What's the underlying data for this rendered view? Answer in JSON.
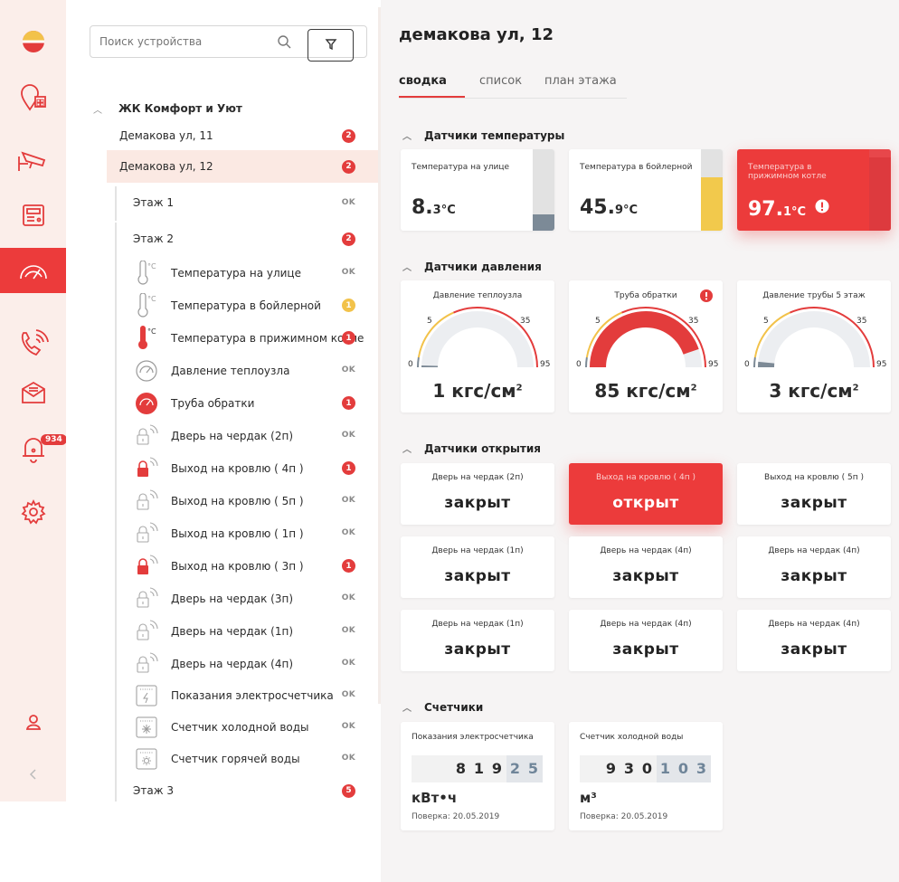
{
  "search": {
    "placeholder": "Поиск устройства"
  },
  "alerts_badge": "934",
  "tree": {
    "complex": "ЖК Комфорт и Уют",
    "buildings": [
      {
        "label": "Демакова ул, 11",
        "count": "2"
      },
      {
        "label": "Демакова ул, 12",
        "count": "2"
      }
    ],
    "floors": [
      {
        "label": "Этаж 1",
        "status": "OK"
      },
      {
        "label": "Этаж 2",
        "count": "2"
      },
      {
        "label": "Этаж 3",
        "count": "5"
      }
    ],
    "devices": [
      {
        "label": "Температура на улице",
        "status": "OK",
        "icon": "thermometer-icon"
      },
      {
        "label": "Температура в бойлерной",
        "count": "1",
        "count_color": "yellow",
        "icon": "thermometer-icon"
      },
      {
        "label": "Температура в прижимном котле",
        "count": "1",
        "icon": "thermometer-alarm-icon"
      },
      {
        "label": "Давление теплоузла",
        "status": "OK",
        "icon": "gauge-icon"
      },
      {
        "label": "Труба обратки",
        "count": "1",
        "icon": "gauge-alarm-icon"
      },
      {
        "label": "Дверь на чердак (2п)",
        "status": "OK",
        "icon": "lock-closed-icon"
      },
      {
        "label": "Выход на кровлю ( 4п )",
        "count": "1",
        "icon": "lock-open-icon"
      },
      {
        "label": "Выход на кровлю ( 5п )",
        "status": "OK",
        "icon": "lock-closed-icon"
      },
      {
        "label": "Выход на кровлю ( 1п )",
        "status": "OK",
        "icon": "lock-closed-icon"
      },
      {
        "label": "Выход на кровлю ( 3п )",
        "count": "1",
        "icon": "lock-open-icon"
      },
      {
        "label": "Дверь на чердак (3п)",
        "status": "OK",
        "icon": "lock-closed-icon"
      },
      {
        "label": "Дверь на чердак (1п)",
        "status": "OK",
        "icon": "lock-closed-icon"
      },
      {
        "label": "Дверь на чердак (4п)",
        "status": "OK",
        "icon": "lock-closed-icon"
      },
      {
        "label": "Показания электросчетчика",
        "status": "OK",
        "icon": "electric-meter-icon"
      },
      {
        "label": "Счетчик холодной воды",
        "status": "OK",
        "icon": "cold-water-meter-icon"
      },
      {
        "label": "Счетчик горячей воды",
        "status": "OK",
        "icon": "hot-water-meter-icon"
      }
    ]
  },
  "main": {
    "title": "демакова ул, 12",
    "tabs": [
      "сводка",
      "список",
      "план этажа"
    ],
    "sections": {
      "temperature": "Датчики температуры",
      "pressure": "Датчики давления",
      "doors": "Датчики открытия",
      "meters": "Счетчики"
    },
    "temps": [
      {
        "name": "Температура на улице",
        "value": "8.",
        "decimal": "3°C",
        "level": 0.2,
        "bar_color": "#7c8a97"
      },
      {
        "name": "Температура в бойлерной",
        "value": "45.",
        "decimal": "9°C",
        "level": 0.66,
        "bar_color": "#f2c94c"
      },
      {
        "name": "Температура в прижимном котле",
        "value": "97.",
        "decimal": "1°C",
        "level": 0.9,
        "bar_color": "#d62f35"
      }
    ],
    "pressures": [
      {
        "name": "Давление теплоузла",
        "value": "1 кгс/см",
        "sup": "2",
        "reading": 1
      },
      {
        "name": "Труба обратки",
        "value": "85 кгс/см",
        "sup": "2",
        "reading": 85
      },
      {
        "name": "Давление трубы 5 этаж",
        "value": "3 кгс/см",
        "sup": "2",
        "reading": 3
      }
    ],
    "gauge_ticks": [
      "0",
      "5",
      "35",
      "95"
    ],
    "doors": [
      {
        "name": "Дверь на чердак (2п)",
        "state": "закрыт"
      },
      {
        "name": "Выход на кровлю ( 4п )",
        "state": "открыт"
      },
      {
        "name": "Выход на кровлю ( 5п )",
        "state": "закрыт"
      },
      {
        "name": "Дверь на чердак (1п)",
        "state": "закрыт"
      },
      {
        "name": "Дверь на чердак (4п)",
        "state": "закрыт"
      },
      {
        "name": "Дверь на чердак (4п)",
        "state": "закрыт"
      },
      {
        "name": "Дверь на чердак (1п)",
        "state": "закрыт"
      },
      {
        "name": "Дверь на чердак (4п)",
        "state": "закрыт"
      },
      {
        "name": "Дверь на чердак (4п)",
        "state": "закрыт"
      }
    ],
    "meters": [
      {
        "name": "Показания электросчетчика",
        "int_digits": [
          "8",
          "1",
          "9"
        ],
        "frac_digits": [
          "2",
          "5"
        ],
        "unit": "кВт•ч",
        "date": "Поверка: 20.05.2019"
      },
      {
        "name": "Счетчик холодной воды",
        "int_digits": [
          "9",
          "3",
          "0"
        ],
        "frac_digits": [
          "1",
          "0",
          "3"
        ],
        "unit": "м³",
        "date": "Поверка: 20.05.2019"
      }
    ]
  }
}
